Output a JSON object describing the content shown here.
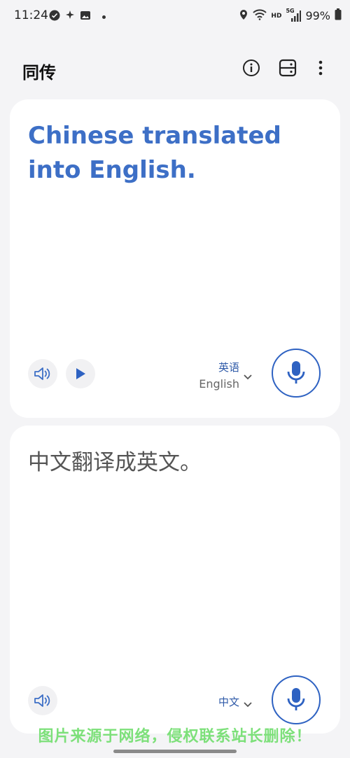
{
  "status_bar": {
    "time": "11:24",
    "network": "HD",
    "signal": "5G",
    "battery": "99%"
  },
  "app_bar": {
    "title": "同传",
    "icons": [
      "info-icon",
      "split-screen-icon",
      "more-vert-icon"
    ]
  },
  "translation_panel": {
    "text": "Chinese translated into English.",
    "language_primary": "英语",
    "language_secondary": "English"
  },
  "source_panel": {
    "text": "中文翻译成英文。",
    "language": "中文"
  },
  "watermark": "图片来源于网络，侵权联系站长删除！",
  "colors": {
    "accent": "#3d6fc6",
    "mic_border": "#2e62c2",
    "background": "#f4f4f6",
    "card": "#ffffff",
    "watermark": "#7de07a"
  }
}
